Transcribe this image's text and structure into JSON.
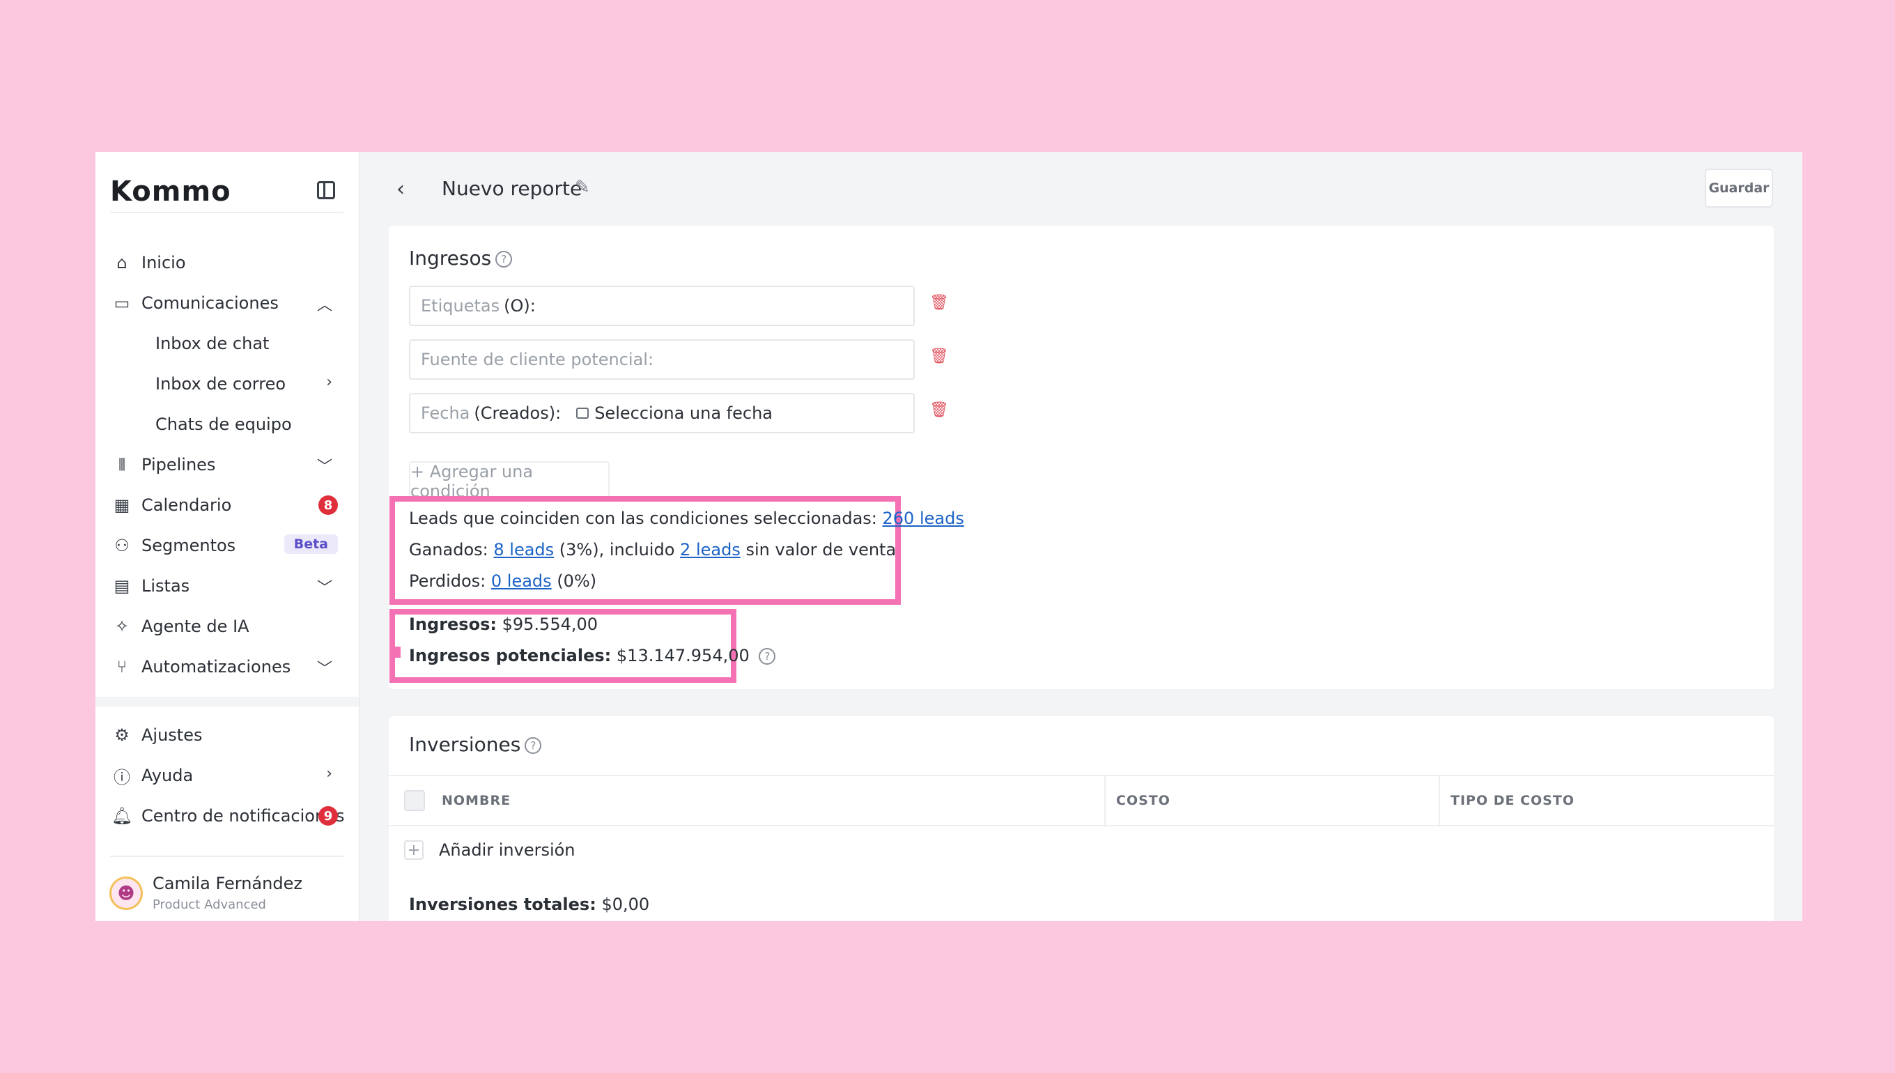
{
  "app": {
    "logo": "Kommo"
  },
  "sidebar": {
    "items": [
      {
        "label": "Inicio",
        "icon": "home-icon"
      },
      {
        "label": "Comunicaciones",
        "icon": "chat-icon",
        "chevron": "up"
      },
      {
        "label": "Inbox de chat",
        "sub": true
      },
      {
        "label": "Inbox de correo",
        "sub": true,
        "chevron": "right"
      },
      {
        "label": "Chats de equipo",
        "sub": true
      },
      {
        "label": "Pipelines",
        "icon": "pipelines-icon",
        "chevron": "down"
      },
      {
        "label": "Calendario",
        "icon": "calendar-icon",
        "badge": "8"
      },
      {
        "label": "Segmentos",
        "icon": "segments-icon",
        "tag": "Beta"
      },
      {
        "label": "Listas",
        "icon": "list-icon",
        "chevron": "down"
      },
      {
        "label": "Agente de IA",
        "icon": "sparkle-icon"
      },
      {
        "label": "Automatizaciones",
        "icon": "automation-icon",
        "chevron": "down"
      }
    ],
    "bottom_items": [
      {
        "label": "Ajustes",
        "icon": "gear-icon"
      },
      {
        "label": "Ayuda",
        "icon": "help-icon",
        "chevron": "right"
      },
      {
        "label": "Centro de notificaciones",
        "icon": "bell-icon",
        "badge": "9"
      }
    ],
    "user": {
      "name": "Camila Fernández",
      "plan": "Product Advanced"
    }
  },
  "header": {
    "title": "Nuevo reporte",
    "save_label": "Guardar"
  },
  "ingresos": {
    "title": "Ingresos",
    "fields": [
      {
        "placeholder": "Etiquetas",
        "value": "(O):"
      },
      {
        "placeholder": "Fuente de cliente potencial:",
        "value": ""
      },
      {
        "placeholder": "Fecha",
        "value": "(Creados):",
        "date_value": "Selecciona una fecha"
      }
    ],
    "add_condition": "+ Agregar una condición",
    "summary": {
      "matching_text": "Leads que coinciden con las condiciones seleccionadas:",
      "matching_link": "260 leads",
      "won_label": "Ganados:",
      "won_link": "8 leads",
      "won_pct": "(3%), incluido",
      "won_novalue_link": "2 leads",
      "won_suffix": "sin valor de venta",
      "lost_label": "Perdidos:",
      "lost_link": "0 leads",
      "lost_pct": "(0%)"
    },
    "revenue_label": "Ingresos:",
    "revenue_value": "$95.554,00",
    "potential_label": "Ingresos potenciales:",
    "potential_value": "$13.147.954,00"
  },
  "inversiones": {
    "title": "Inversiones",
    "columns": [
      "NOMBRE",
      "COSTO",
      "TIPO DE COSTO"
    ],
    "add_label": "Añadir inversión",
    "total_label": "Inversiones totales:",
    "total_value": "$0,00"
  },
  "colors": {
    "background": "#fcc8df",
    "highlight": "#f472b4",
    "link": "#1b63c7",
    "badge": "#e02f3c",
    "ai_button": "#7b6ef6"
  }
}
